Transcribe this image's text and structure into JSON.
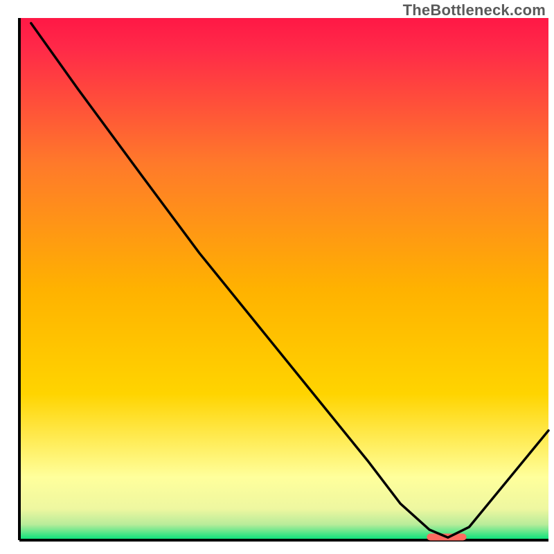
{
  "attribution": "TheBottleneck.com",
  "chart_data": {
    "type": "line",
    "title": "",
    "xlabel": "",
    "ylabel": "",
    "xlim": [
      0,
      100
    ],
    "ylim": [
      0,
      100
    ],
    "grid": false,
    "legend": false,
    "background_gradient": {
      "top": "#ff1846",
      "mid": "#ffd400",
      "near_bottom": "#ffff9c",
      "bottom": "#00e27a"
    },
    "series": [
      {
        "name": "curve",
        "color": "#000000",
        "x": [
          2.2,
          11,
          23,
          34,
          46,
          58,
          66,
          72,
          77.5,
          81,
          85,
          100
        ],
        "values": [
          99,
          86.5,
          70,
          55,
          40,
          25,
          15,
          7,
          2,
          0.5,
          2.5,
          21
        ]
      }
    ],
    "marker": {
      "name": "highlight",
      "color": "#ff6a60",
      "x_start": 77,
      "x_end": 84.5,
      "y": 0.6
    },
    "axes": {
      "color": "#000000",
      "left_x": 2.5,
      "bottom_y": 0
    }
  }
}
